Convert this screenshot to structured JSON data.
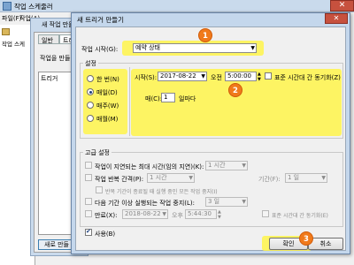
{
  "background_app": {
    "title": "작업 스케줄러",
    "menu": [
      "파일(F)",
      "작업(A)"
    ],
    "close_glyph": "✕",
    "tree_item": "작업 스케"
  },
  "background_dialog": {
    "title": "새 작업 만들",
    "tabs": [
      "일반",
      "트리"
    ],
    "description": "작업을 만들",
    "list_header": "트리거",
    "new_button": "새로 만들"
  },
  "dialog": {
    "title": "새 트리거 만들기",
    "close_glyph": "✕",
    "start_task_label": "작업 시작(G):",
    "start_task_value": "예약 상태",
    "settings_label": "설정",
    "frequency_options": [
      {
        "label": "한 번(N)",
        "selected": false
      },
      {
        "label": "매일(D)",
        "selected": true
      },
      {
        "label": "매주(W)",
        "selected": false
      },
      {
        "label": "매월(M)",
        "selected": false
      }
    ],
    "start_label": "시작(S):",
    "start_date": "2017-08-22",
    "ampm": "오전",
    "start_time": "5:00:00",
    "sync_timezone_label": "표준 시간대 간 동기화(Z)",
    "recur_label": "매(C):",
    "recur_value": "1",
    "recur_unit": "일마다",
    "advanced_label": "고급 설정",
    "delay_label": "작업이 지연되는 최대 시간(임의 지연)(K):",
    "delay_value": "1 시간",
    "repeat_label": "작업 반복 간격(P):",
    "repeat_value": "1 시간",
    "duration_label": "기간(F):",
    "duration_value": "1 일",
    "stop_running_label": "반복 기간이 종료될 때 실행 중인 모든 작업 중지(I)",
    "stop_longer_label": "다음 기간 이상 실행되는 작업 중지(L):",
    "stop_longer_value": "3 일",
    "expire_label": "만료(X):",
    "expire_date": "2018-08-22",
    "expire_ampm": "오후",
    "expire_time": "5:44:30",
    "expire_sync_label": "표준 시간대 간 동기화(E)",
    "enabled_label": "사용(B)",
    "ok_label": "확인",
    "cancel_label": "취소"
  },
  "callouts": [
    "1",
    "2",
    "3"
  ],
  "colors": {
    "highlight": "#fff54a",
    "callout": "#f07a1b",
    "close": "#c7513e"
  }
}
